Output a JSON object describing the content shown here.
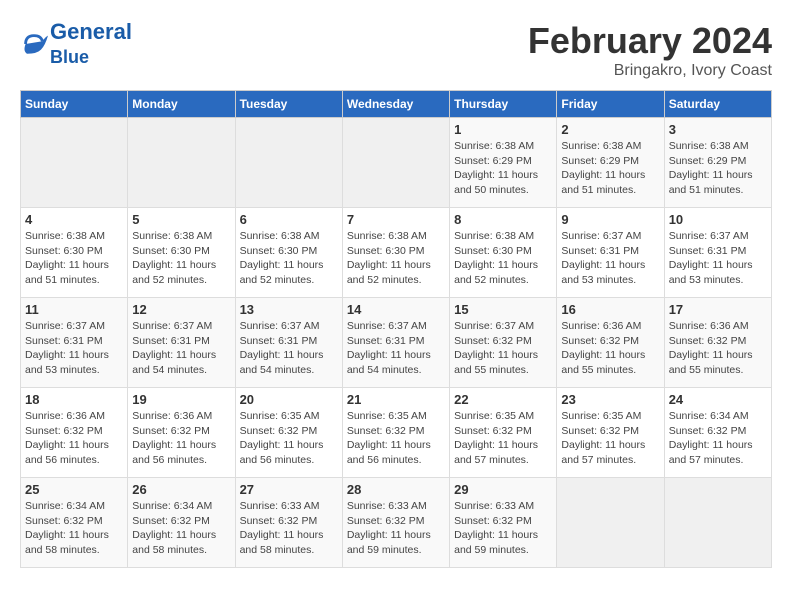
{
  "header": {
    "logo_line1": "General",
    "logo_line2": "Blue",
    "month_year": "February 2024",
    "subtitle": "Bringakro, Ivory Coast"
  },
  "calendar": {
    "days_of_week": [
      "Sunday",
      "Monday",
      "Tuesday",
      "Wednesday",
      "Thursday",
      "Friday",
      "Saturday"
    ],
    "weeks": [
      [
        {
          "day": "",
          "info": ""
        },
        {
          "day": "",
          "info": ""
        },
        {
          "day": "",
          "info": ""
        },
        {
          "day": "",
          "info": ""
        },
        {
          "day": "1",
          "info": "Sunrise: 6:38 AM\nSunset: 6:29 PM\nDaylight: 11 hours\nand 50 minutes."
        },
        {
          "day": "2",
          "info": "Sunrise: 6:38 AM\nSunset: 6:29 PM\nDaylight: 11 hours\nand 51 minutes."
        },
        {
          "day": "3",
          "info": "Sunrise: 6:38 AM\nSunset: 6:29 PM\nDaylight: 11 hours\nand 51 minutes."
        }
      ],
      [
        {
          "day": "4",
          "info": "Sunrise: 6:38 AM\nSunset: 6:30 PM\nDaylight: 11 hours\nand 51 minutes."
        },
        {
          "day": "5",
          "info": "Sunrise: 6:38 AM\nSunset: 6:30 PM\nDaylight: 11 hours\nand 52 minutes."
        },
        {
          "day": "6",
          "info": "Sunrise: 6:38 AM\nSunset: 6:30 PM\nDaylight: 11 hours\nand 52 minutes."
        },
        {
          "day": "7",
          "info": "Sunrise: 6:38 AM\nSunset: 6:30 PM\nDaylight: 11 hours\nand 52 minutes."
        },
        {
          "day": "8",
          "info": "Sunrise: 6:38 AM\nSunset: 6:30 PM\nDaylight: 11 hours\nand 52 minutes."
        },
        {
          "day": "9",
          "info": "Sunrise: 6:37 AM\nSunset: 6:31 PM\nDaylight: 11 hours\nand 53 minutes."
        },
        {
          "day": "10",
          "info": "Sunrise: 6:37 AM\nSunset: 6:31 PM\nDaylight: 11 hours\nand 53 minutes."
        }
      ],
      [
        {
          "day": "11",
          "info": "Sunrise: 6:37 AM\nSunset: 6:31 PM\nDaylight: 11 hours\nand 53 minutes."
        },
        {
          "day": "12",
          "info": "Sunrise: 6:37 AM\nSunset: 6:31 PM\nDaylight: 11 hours\nand 54 minutes."
        },
        {
          "day": "13",
          "info": "Sunrise: 6:37 AM\nSunset: 6:31 PM\nDaylight: 11 hours\nand 54 minutes."
        },
        {
          "day": "14",
          "info": "Sunrise: 6:37 AM\nSunset: 6:31 PM\nDaylight: 11 hours\nand 54 minutes."
        },
        {
          "day": "15",
          "info": "Sunrise: 6:37 AM\nSunset: 6:32 PM\nDaylight: 11 hours\nand 55 minutes."
        },
        {
          "day": "16",
          "info": "Sunrise: 6:36 AM\nSunset: 6:32 PM\nDaylight: 11 hours\nand 55 minutes."
        },
        {
          "day": "17",
          "info": "Sunrise: 6:36 AM\nSunset: 6:32 PM\nDaylight: 11 hours\nand 55 minutes."
        }
      ],
      [
        {
          "day": "18",
          "info": "Sunrise: 6:36 AM\nSunset: 6:32 PM\nDaylight: 11 hours\nand 56 minutes."
        },
        {
          "day": "19",
          "info": "Sunrise: 6:36 AM\nSunset: 6:32 PM\nDaylight: 11 hours\nand 56 minutes."
        },
        {
          "day": "20",
          "info": "Sunrise: 6:35 AM\nSunset: 6:32 PM\nDaylight: 11 hours\nand 56 minutes."
        },
        {
          "day": "21",
          "info": "Sunrise: 6:35 AM\nSunset: 6:32 PM\nDaylight: 11 hours\nand 56 minutes."
        },
        {
          "day": "22",
          "info": "Sunrise: 6:35 AM\nSunset: 6:32 PM\nDaylight: 11 hours\nand 57 minutes."
        },
        {
          "day": "23",
          "info": "Sunrise: 6:35 AM\nSunset: 6:32 PM\nDaylight: 11 hours\nand 57 minutes."
        },
        {
          "day": "24",
          "info": "Sunrise: 6:34 AM\nSunset: 6:32 PM\nDaylight: 11 hours\nand 57 minutes."
        }
      ],
      [
        {
          "day": "25",
          "info": "Sunrise: 6:34 AM\nSunset: 6:32 PM\nDaylight: 11 hours\nand 58 minutes."
        },
        {
          "day": "26",
          "info": "Sunrise: 6:34 AM\nSunset: 6:32 PM\nDaylight: 11 hours\nand 58 minutes."
        },
        {
          "day": "27",
          "info": "Sunrise: 6:33 AM\nSunset: 6:32 PM\nDaylight: 11 hours\nand 58 minutes."
        },
        {
          "day": "28",
          "info": "Sunrise: 6:33 AM\nSunset: 6:32 PM\nDaylight: 11 hours\nand 59 minutes."
        },
        {
          "day": "29",
          "info": "Sunrise: 6:33 AM\nSunset: 6:32 PM\nDaylight: 11 hours\nand 59 minutes."
        },
        {
          "day": "",
          "info": ""
        },
        {
          "day": "",
          "info": ""
        }
      ]
    ]
  }
}
